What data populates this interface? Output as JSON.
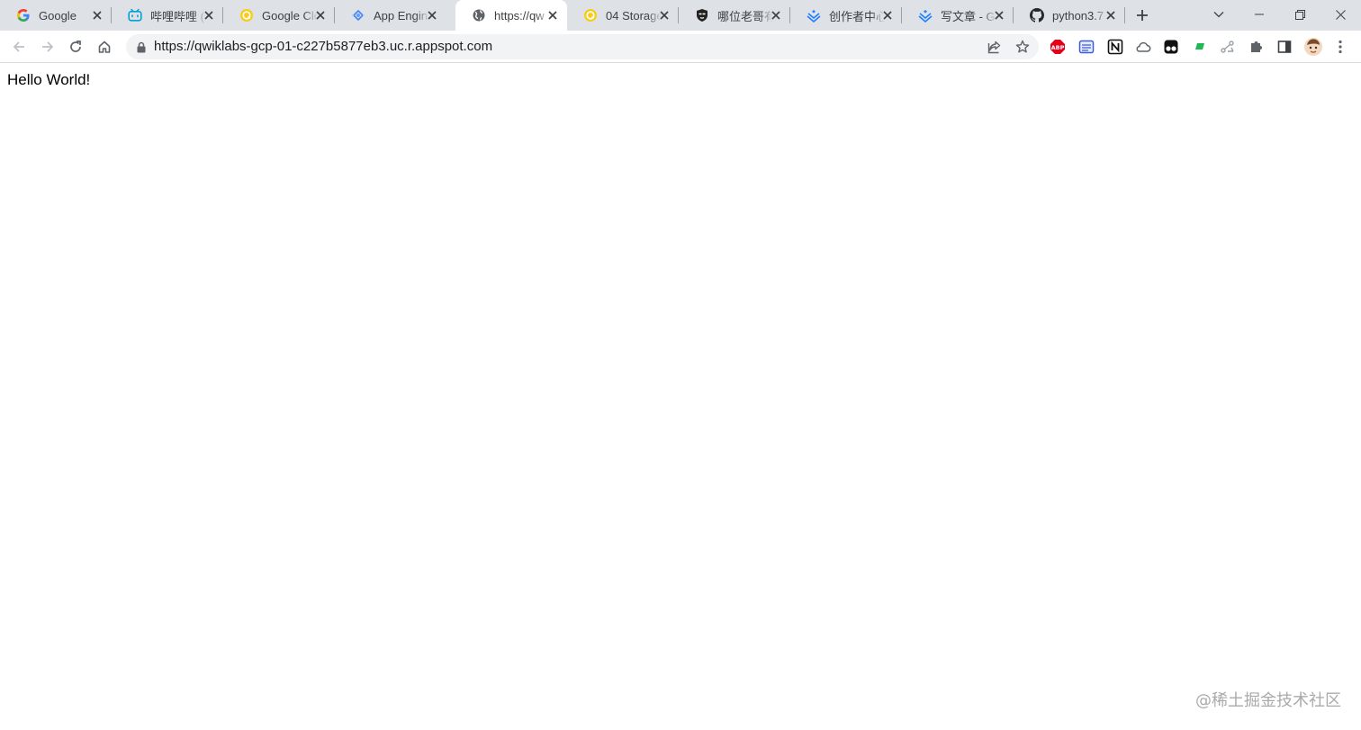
{
  "tabs": [
    {
      "title": "Google",
      "icon": "google-g-icon"
    },
    {
      "title": "哔哩哔哩 (",
      "icon": "bilibili-tv-icon"
    },
    {
      "title": "Google Clo",
      "icon": "qwiklabs-icon"
    },
    {
      "title": "App Engin",
      "icon": "app-engine-icon"
    },
    {
      "title": "https://qw",
      "icon": "globe-icon",
      "active": true
    },
    {
      "title": "04 Storage",
      "icon": "qwiklabs-icon"
    },
    {
      "title": "哪位老哥有",
      "icon": "avatar-mask-icon"
    },
    {
      "title": "创作者中心",
      "icon": "juejin-icon"
    },
    {
      "title": "写文章 - G",
      "icon": "juejin-icon"
    },
    {
      "title": "python3.7",
      "icon": "github-icon"
    }
  ],
  "omnibox": {
    "url": "https://qwiklabs-gcp-01-c227b5877eb3.uc.r.appspot.com"
  },
  "extensions": [
    "adblock-plus-icon",
    "reader-icon",
    "notion-icon",
    "cloud-icon",
    "tampermonkey-icon",
    "green-flag-icon",
    "share-graph-icon",
    "puzzle-icon",
    "side-panel-icon",
    "profile-avatar-icon",
    "menu-icon"
  ],
  "page": {
    "text": "Hello World!"
  },
  "watermark": "@稀土掘金技术社区",
  "colors": {
    "tabstrip": "#dee1e6",
    "active_tab": "#ffffff",
    "omnibox": "#f1f3f4",
    "abp_red": "#e3001b",
    "qwiklabs_yellow": "#f8cc1b",
    "bilibili_blue": "#00a1d6",
    "juejin_blue": "#1e80ff"
  }
}
